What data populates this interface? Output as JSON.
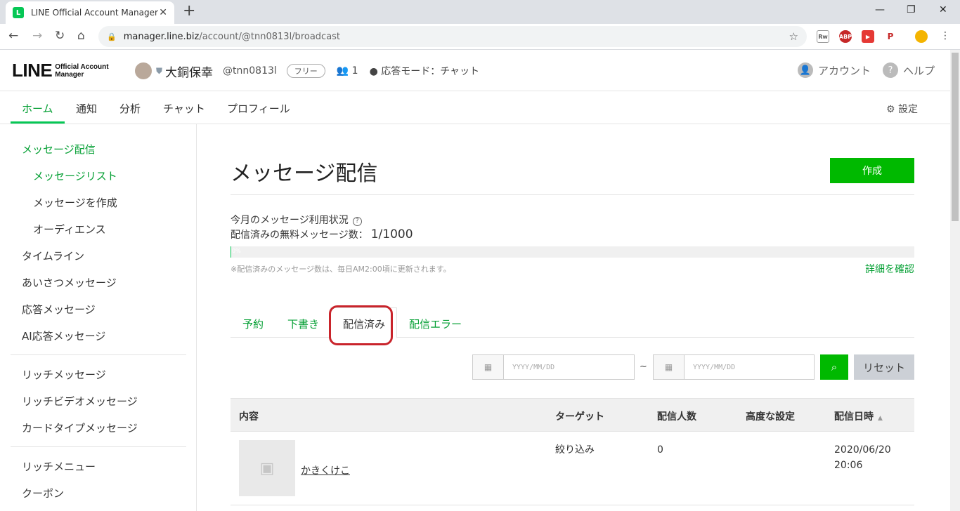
{
  "browser": {
    "tab_title": "LINE Official Account Manager",
    "url_host": "manager.line.biz",
    "url_path": "/account/@tnn0813l/broadcast"
  },
  "header": {
    "logo_line": "LINE",
    "logo_sub1": "Official Account",
    "logo_sub2": "Manager",
    "account_name": "大銅保幸",
    "account_id": "@tnn0813l",
    "plan": "フリー",
    "friends": "1",
    "reply_mode": "応答モード：チャット",
    "account_label": "アカウント",
    "help_label": "ヘルプ"
  },
  "mainnav": {
    "items": [
      "ホーム",
      "通知",
      "分析",
      "チャット",
      "プロフィール"
    ],
    "settings": "設定"
  },
  "sidebar": {
    "items": [
      "メッセージ配信",
      "メッセージリスト",
      "メッセージを作成",
      "オーディエンス",
      "タイムライン",
      "あいさつメッセージ",
      "応答メッセージ",
      "AI応答メッセージ",
      "リッチメッセージ",
      "リッチビデオメッセージ",
      "カードタイプメッセージ",
      "リッチメニュー",
      "クーポン"
    ]
  },
  "content": {
    "title": "メッセージ配信",
    "create_button": "作成",
    "usage_label": "今月のメッセージ利用状況",
    "usage_count_label": "配信済みの無料メッセージ数：",
    "usage_count": "1/1000",
    "progress_text": "0%",
    "progress_fraction": 0.001,
    "note": "※配信済みのメッセージ数は、毎日AM2:00頃に更新されます。",
    "detail_link": "詳細を確認",
    "tabs": [
      "予約",
      "下書き",
      "配信済み",
      "配信エラー"
    ],
    "date_placeholder": "YYYY/MM/DD",
    "tilde": "~",
    "reset_button": "リセット",
    "table": {
      "headers": [
        "内容",
        "ターゲット",
        "配信人数",
        "高度な設定",
        "配信日時"
      ],
      "rows": [
        {
          "title": "かきくけこ",
          "target": "絞り込み",
          "count": "0",
          "advanced": "",
          "date": "2020/06/20",
          "time": "20:06"
        }
      ]
    }
  },
  "colors": {
    "brand_green": "#06c755",
    "button_green": "#00b900",
    "highlight_red": "#c9242b"
  }
}
